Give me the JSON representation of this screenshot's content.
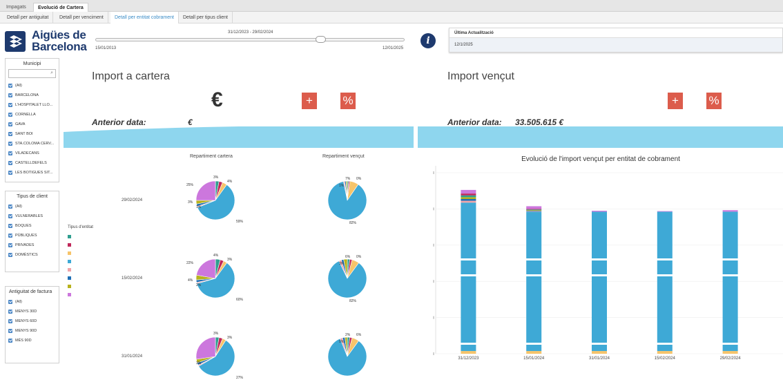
{
  "tabs": [
    {
      "label": "Impagats",
      "active": false
    },
    {
      "label": "Evolució de Cartera",
      "active": true
    }
  ],
  "subtabs": [
    {
      "label": "Detall per antiguitat",
      "active": false
    },
    {
      "label": "Detall per venciment",
      "active": false
    },
    {
      "label": "Detall per entitat cobrament",
      "active": true
    },
    {
      "label": "Detall per tipus client",
      "active": false
    }
  ],
  "logo": {
    "line1": "Aigües de",
    "line2": "Barcelona"
  },
  "date_slider": {
    "range_label": "31/12/2023 - 29/02/2024",
    "min_label": "15/01/2013",
    "max_label": "12/01/2025"
  },
  "last_update": {
    "header": "Última Actualització",
    "value": "12/1/2025"
  },
  "filters": {
    "municipi": {
      "title": "Municipi",
      "items": [
        "(All)",
        "BARCELONA",
        "L'HOSPITALET LLO...",
        "CORNELLA",
        "GAVA",
        "SANT BOI",
        "STA.COLOMA CERV...",
        "VILADECANS",
        "CASTELLDEFELS",
        "LES BOTIGUES SIT..."
      ]
    },
    "tipus_client": {
      "title": "Tipus de client",
      "items": [
        "(All)",
        "VULNERABLES",
        "BOQUES",
        "PÚBLIQUES",
        "PRIVADES",
        "DOMÈSTICS"
      ]
    },
    "antiguitat": {
      "title": "Antiguitat de factura",
      "items": [
        "(All)",
        "MENYS 30D",
        "MENYS 60D",
        "MENYS 90D",
        "MÉS 90D"
      ]
    }
  },
  "kpis": {
    "cartera": {
      "title": "Import a cartera",
      "value": "€",
      "plus": "+",
      "pct": "%",
      "anterior_label": "Anterior data:",
      "anterior_value": "€"
    },
    "vencut": {
      "title": "Import vençut",
      "plus": "+",
      "pct": "%",
      "anterior_label": "Anterior data:",
      "anterior_value": "33.505.615 €"
    }
  },
  "pies": {
    "cartera_title": "Repartiment cartera",
    "vencut_title": "Repartiment vençut",
    "legend_title": "Tipus d'entitat",
    "colors": [
      "#2f9e8f",
      "#c0285a",
      "#f6c46a",
      "#3ea9d6",
      "#f0a3a8",
      "#1f6fb5",
      "#b8b21c",
      "#cc77dd"
    ],
    "rows": [
      {
        "date": "29/02/2024",
        "cartera": {
          "values": [
            3,
            3,
            4,
            59,
            1,
            2,
            3,
            25
          ],
          "labels": [
            "3%",
            "4%",
            "59%",
            "1%",
            "3%",
            "25%"
          ]
        },
        "vencut": {
          "values": [
            1,
            1,
            7,
            82,
            1,
            1,
            1,
            0
          ],
          "labels": [
            "7%",
            "0%",
            "1%",
            "82%"
          ]
        }
      },
      {
        "date": "15/02/2024",
        "cartera": {
          "values": [
            4,
            3,
            3,
            60,
            1,
            2,
            4,
            22
          ],
          "labels": [
            "4%",
            "3%",
            "60%",
            "2%",
            "4%",
            "22%"
          ]
        },
        "vencut": {
          "values": [
            2,
            2,
            6,
            82,
            2,
            2,
            3,
            0
          ],
          "labels": [
            "6%",
            "0%",
            "3%",
            "82%"
          ]
        }
      },
      {
        "date": "31/01/2024",
        "cartera": {
          "values": [
            3,
            3,
            3,
            57,
            1,
            2,
            3,
            27
          ],
          "labels": [
            "3%",
            "3%",
            "27%",
            "3%"
          ]
        },
        "vencut": {
          "values": [
            2,
            2,
            6,
            84,
            2,
            2,
            2,
            0
          ],
          "labels": [
            "2%",
            "6%",
            "0%"
          ]
        }
      }
    ]
  },
  "chart_data": {
    "type": "bar",
    "title": "Evolució de l'import vençut per entitat de cobrament",
    "categories": [
      "31/12/2023",
      "15/01/2024",
      "31/01/2024",
      "15/02/2024",
      "29/02/2024"
    ],
    "series_colors": [
      "#f6c46a",
      "#3ea9d6",
      "#f0a3a8",
      "#1f6fb5",
      "#b8b21c",
      "#2f9e8f",
      "#c0285a",
      "#cc77dd"
    ],
    "segments_note": "stacked",
    "series": [
      {
        "values": [
          1.5,
          1.5,
          1.5,
          1.5,
          1.5
        ]
      },
      {
        "values": [
          82,
          77,
          77,
          77,
          77
        ]
      },
      {
        "values": [
          1,
          0.3,
          0,
          0,
          0
        ]
      },
      {
        "values": [
          1,
          0.3,
          0,
          0,
          0
        ]
      },
      {
        "values": [
          1,
          0.3,
          0,
          0,
          0
        ]
      },
      {
        "values": [
          1,
          0.3,
          0,
          0,
          0
        ]
      },
      {
        "values": [
          1,
          0.3,
          0,
          0,
          0
        ]
      },
      {
        "values": [
          2,
          1.5,
          0.5,
          0.3,
          0.8
        ]
      }
    ],
    "ylim": [
      0,
      100
    ],
    "grid": true,
    "yticks_shown": false
  }
}
